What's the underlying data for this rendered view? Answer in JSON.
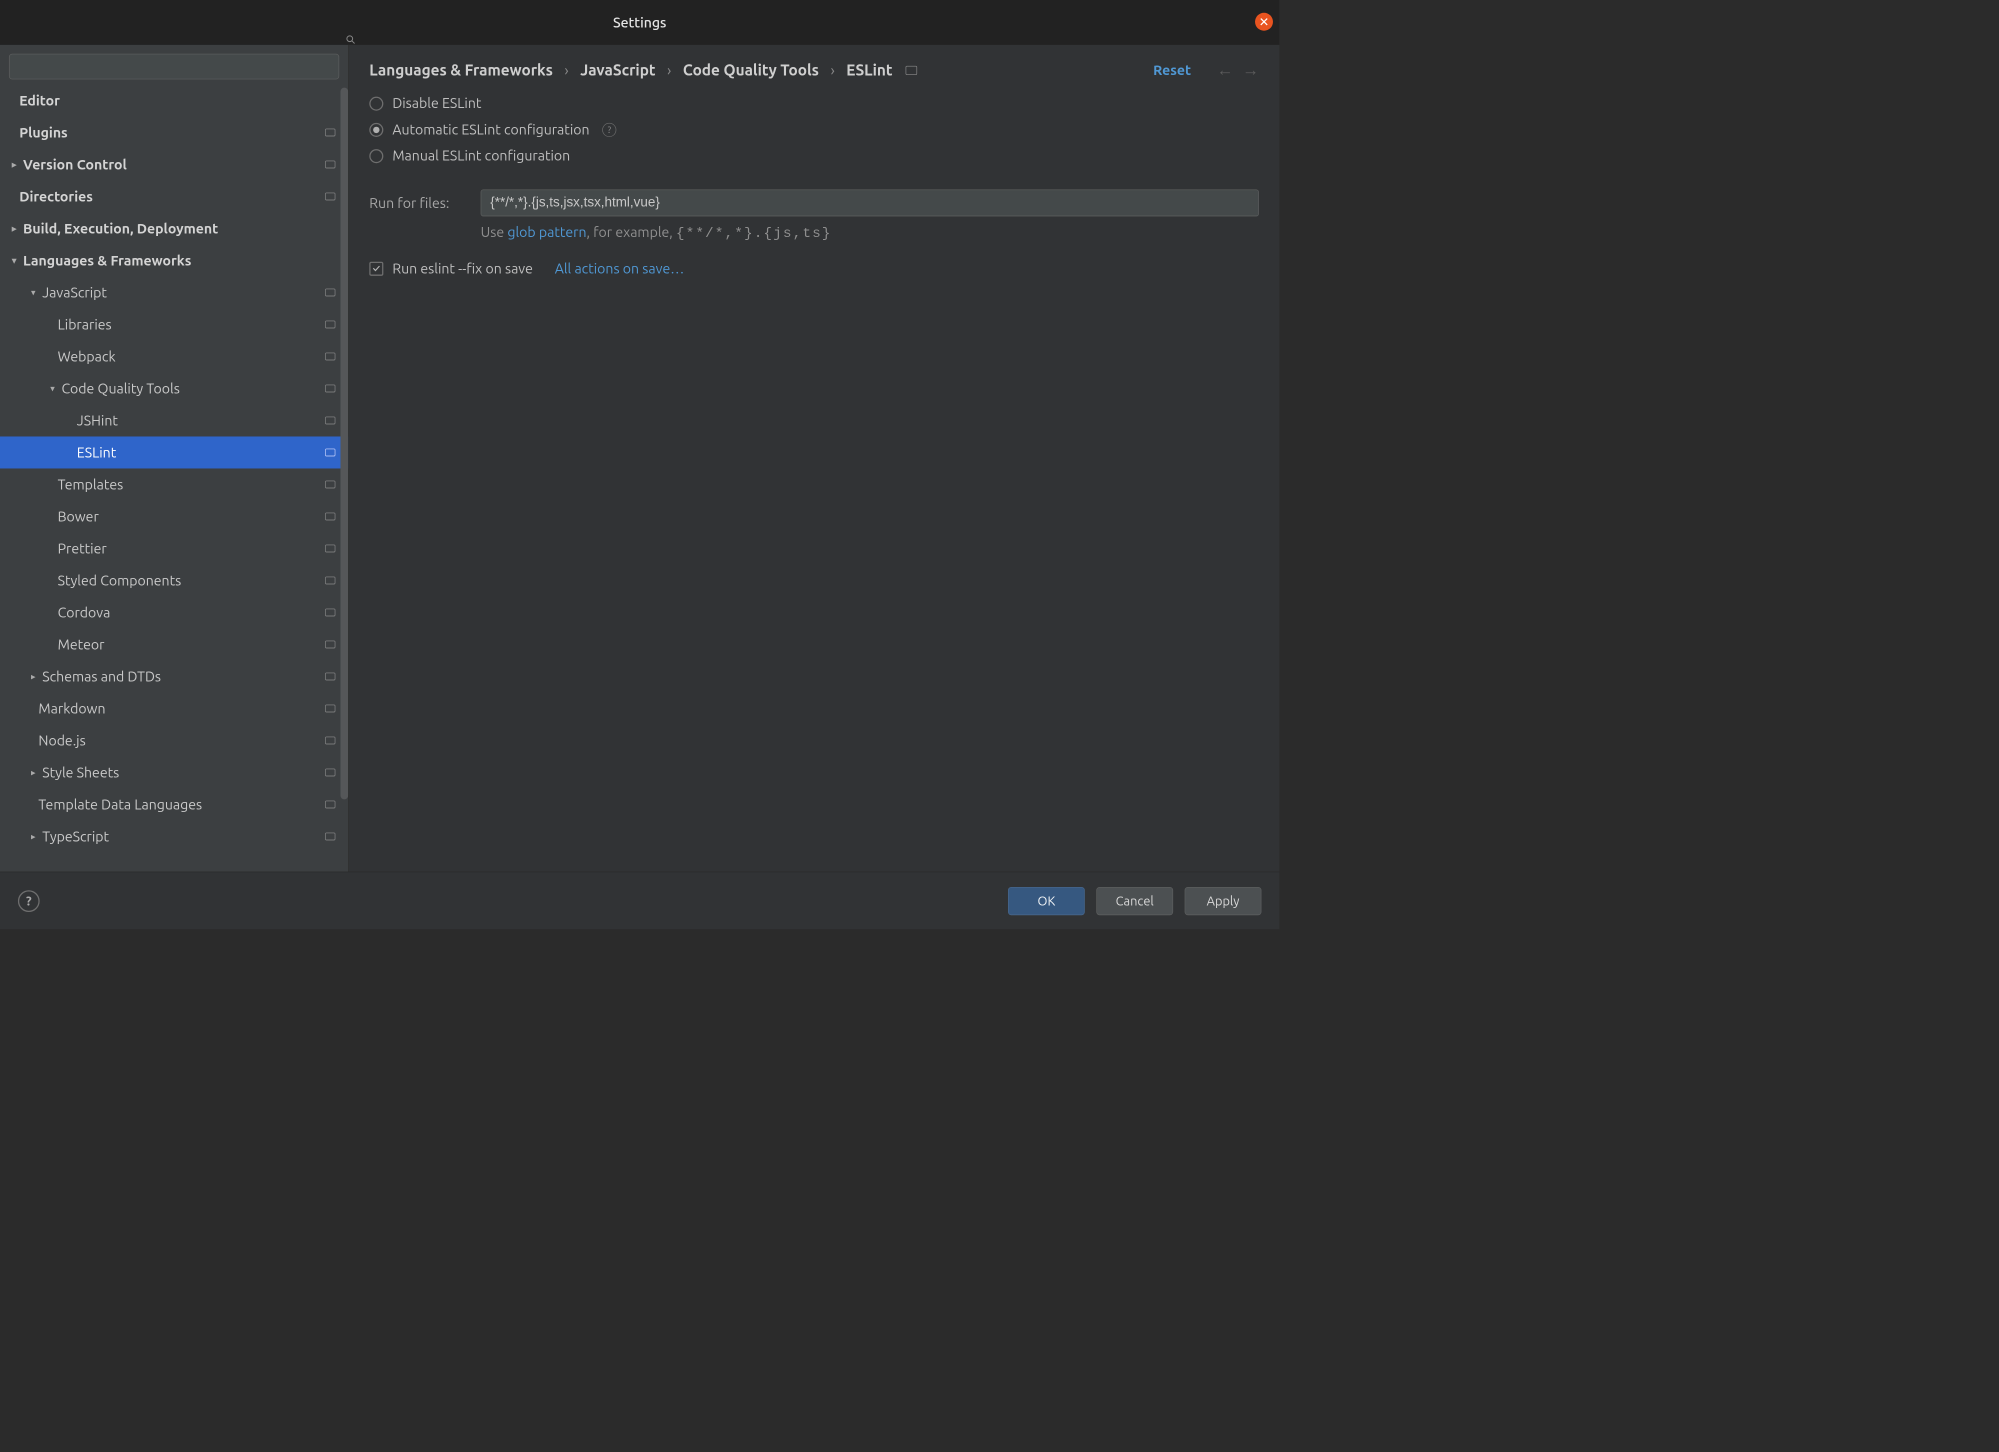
{
  "title": "Settings",
  "search": {
    "placeholder": ""
  },
  "tree": [
    {
      "label": "Editor",
      "indent": 1,
      "chevron": "",
      "bold": true,
      "badge": false
    },
    {
      "label": "Plugins",
      "indent": 1,
      "chevron": "",
      "bold": true,
      "badge": true
    },
    {
      "label": "Version Control",
      "indent": 1,
      "chevron": "›",
      "bold": true,
      "badge": true
    },
    {
      "label": "Directories",
      "indent": 1,
      "chevron": "",
      "bold": true,
      "badge": true
    },
    {
      "label": "Build, Execution, Deployment",
      "indent": 1,
      "chevron": "›",
      "bold": true,
      "badge": false
    },
    {
      "label": "Languages & Frameworks",
      "indent": 1,
      "chevron": "⌄",
      "bold": true,
      "badge": false
    },
    {
      "label": "JavaScript",
      "indent": 2,
      "chevron": "⌄",
      "bold": false,
      "badge": true
    },
    {
      "label": "Libraries",
      "indent": 3,
      "chevron": "",
      "bold": false,
      "badge": true
    },
    {
      "label": "Webpack",
      "indent": 3,
      "chevron": "",
      "bold": false,
      "badge": true
    },
    {
      "label": "Code Quality Tools",
      "indent": 3,
      "chevron": "⌄",
      "bold": false,
      "badge": true
    },
    {
      "label": "JSHint",
      "indent": 4,
      "chevron": "",
      "bold": false,
      "badge": true
    },
    {
      "label": "ESLint",
      "indent": 4,
      "chevron": "",
      "bold": false,
      "badge": true,
      "selected": true
    },
    {
      "label": "Templates",
      "indent": 3,
      "chevron": "",
      "bold": false,
      "badge": true
    },
    {
      "label": "Bower",
      "indent": 3,
      "chevron": "",
      "bold": false,
      "badge": true
    },
    {
      "label": "Prettier",
      "indent": 3,
      "chevron": "",
      "bold": false,
      "badge": true
    },
    {
      "label": "Styled Components",
      "indent": 3,
      "chevron": "",
      "bold": false,
      "badge": true
    },
    {
      "label": "Cordova",
      "indent": 3,
      "chevron": "",
      "bold": false,
      "badge": true
    },
    {
      "label": "Meteor",
      "indent": 3,
      "chevron": "",
      "bold": false,
      "badge": true
    },
    {
      "label": "Schemas and DTDs",
      "indent": 2,
      "chevron": "›",
      "bold": false,
      "badge": true
    },
    {
      "label": "Markdown",
      "indent": 2,
      "chevron": "",
      "bold": false,
      "badge": true
    },
    {
      "label": "Node.js",
      "indent": 2,
      "chevron": "",
      "bold": false,
      "badge": true
    },
    {
      "label": "Style Sheets",
      "indent": 2,
      "chevron": "›",
      "bold": false,
      "badge": true
    },
    {
      "label": "Template Data Languages",
      "indent": 2,
      "chevron": "",
      "bold": false,
      "badge": true
    },
    {
      "label": "TypeScript",
      "indent": 2,
      "chevron": "›",
      "bold": false,
      "badge": true
    }
  ],
  "breadcrumb": [
    "Languages & Frameworks",
    "JavaScript",
    "Code Quality Tools",
    "ESLint"
  ],
  "reset": "Reset",
  "radios": {
    "disable": "Disable ESLint",
    "auto": "Automatic ESLint configuration",
    "manual": "Manual ESLint configuration"
  },
  "runfor": {
    "label": "Run for files:",
    "value": "{**/*,*}.{js,ts,jsx,tsx,html,vue}",
    "hint_prefix": "Use ",
    "hint_link": "glob pattern",
    "hint_mid": ", for example, ",
    "hint_example": "{**/*,*}.{js,ts}"
  },
  "fixsave": {
    "label": "Run eslint --fix on save",
    "link": "All actions on save…"
  },
  "footer": {
    "ok": "OK",
    "cancel": "Cancel",
    "apply": "Apply"
  }
}
